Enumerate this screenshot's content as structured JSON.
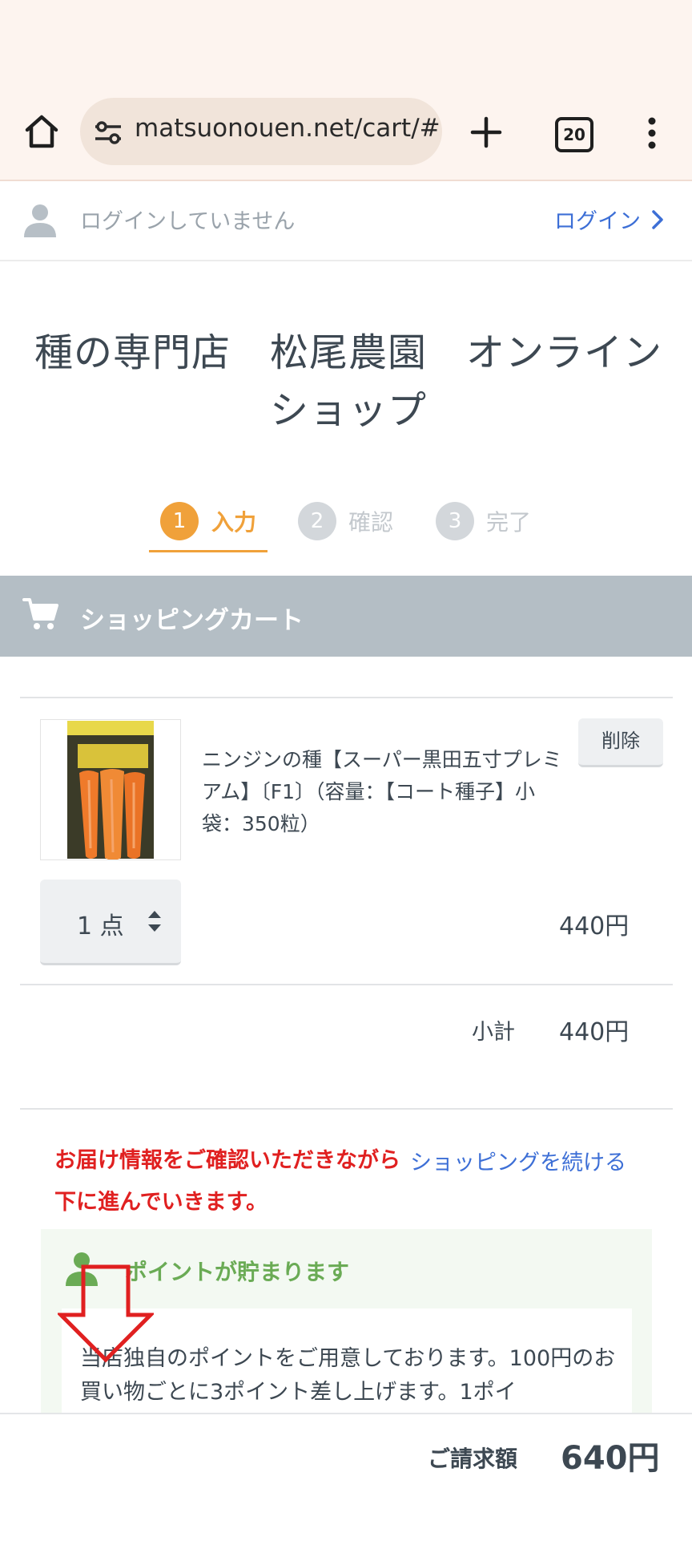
{
  "browser": {
    "url": "matsuonouen.net/cart/#",
    "tab_count": "20",
    "icons": [
      "home-icon",
      "site-settings-icon",
      "new-tab-icon",
      "tab-switcher-icon",
      "more-vert-icon"
    ]
  },
  "login_bar": {
    "status": "ログインしていません",
    "login_link": "ログイン"
  },
  "site": {
    "title_line1": "種の専門店　松尾農園　オンライン",
    "title_line2": "ショップ"
  },
  "steps": [
    {
      "number": "1",
      "label": "入力",
      "active": true
    },
    {
      "number": "2",
      "label": "確認",
      "active": false
    },
    {
      "number": "3",
      "label": "完了",
      "active": false
    }
  ],
  "cart": {
    "header": "ショッピングカート",
    "item": {
      "name": "ニンジンの種【スーパー黒田五寸プレミアム】〔F1〕（容量：【コート種子】小袋：350粒）",
      "delete_label": "削除",
      "quantity": "1 点",
      "price": "440円"
    },
    "subtotal_label": "小計",
    "subtotal": "440円"
  },
  "notice": {
    "line1": "お届け情報をご確認いただきながら",
    "line2": "下に進んでいきます。",
    "continue_link": "ショッピングを続ける"
  },
  "points": {
    "title": "ポイントが貯まります",
    "text": "当店独自のポイントをご用意しております。100円のお買い物ごとに3ポイント差し上げます。1ポイ"
  },
  "total": {
    "label": "ご請求額",
    "value": "640円"
  },
  "colors": {
    "accent_orange": "#f0a13a",
    "link_blue": "#3d6fd6",
    "notice_red": "#e02020",
    "points_green": "#6aab55",
    "cart_header_gray": "#b4bec5"
  }
}
